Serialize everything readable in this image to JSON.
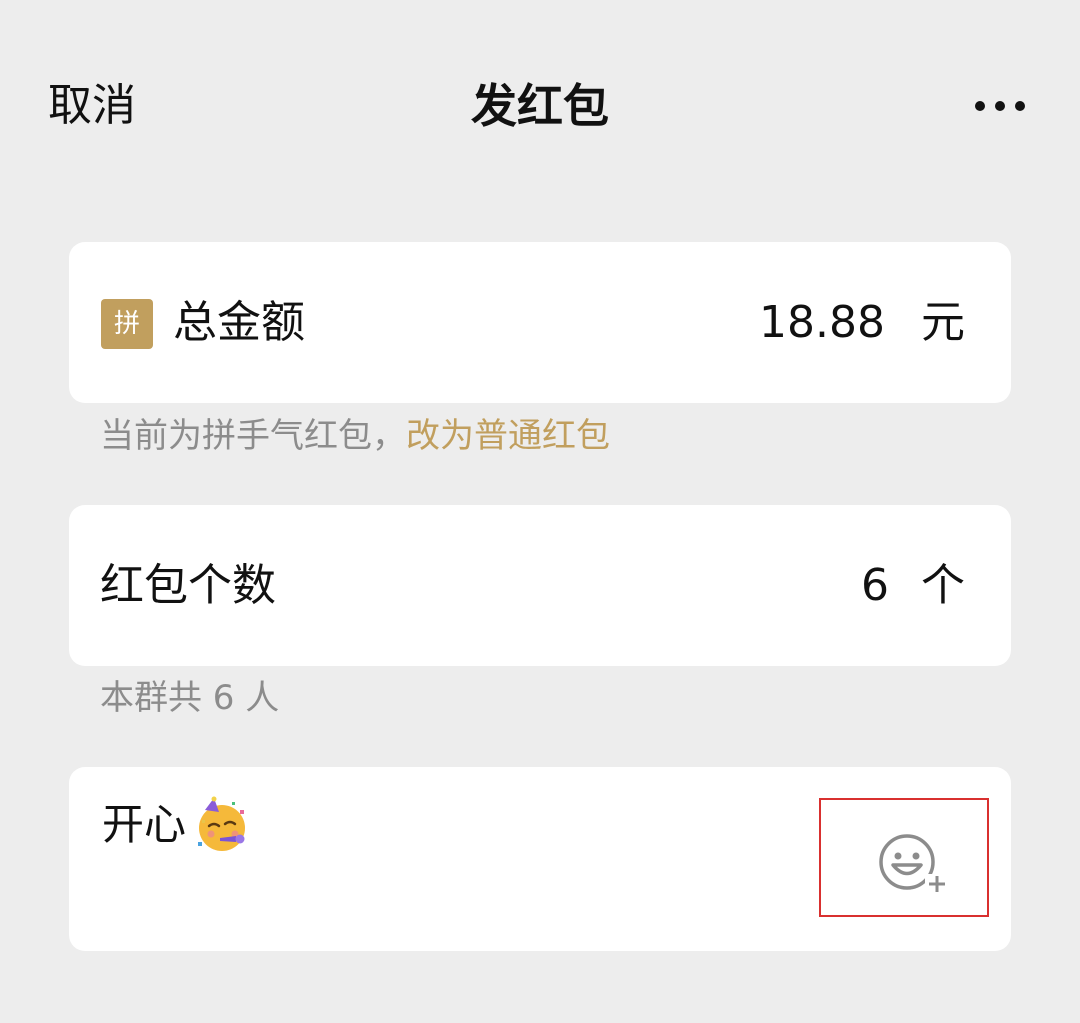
{
  "nav": {
    "cancel_label": "取消",
    "title": "发红包",
    "more_icon": "more-dots-icon"
  },
  "amount": {
    "badge_text": "拼",
    "label": "总金额",
    "value": "18.88",
    "unit": "元"
  },
  "amount_note": {
    "text": "当前为拼手气红包，",
    "link": "改为普通红包"
  },
  "count": {
    "label": "红包个数",
    "value": "6",
    "unit": "个"
  },
  "count_note": {
    "text": "本群共 6 人"
  },
  "message": {
    "text": "开心",
    "emoji_icon": "partying-face-icon",
    "add_emoji_icon": "add-emoji-icon"
  },
  "colors": {
    "background": "#ededed",
    "card": "#ffffff",
    "accent_gold": "#c19f5e",
    "muted_text": "#8c8c8c",
    "highlight_border": "#d9302f"
  }
}
